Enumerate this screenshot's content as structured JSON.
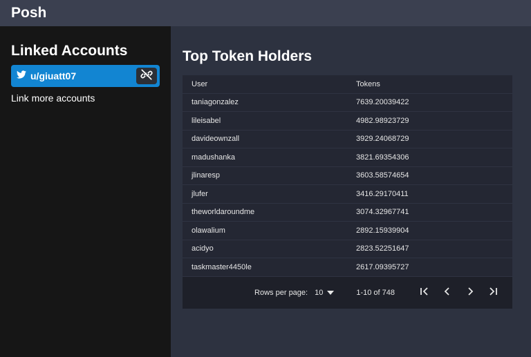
{
  "app": {
    "title": "Posh"
  },
  "sidebar": {
    "heading": "Linked Accounts",
    "account": {
      "name": "u/giuatt07",
      "icon": "twitter-icon"
    },
    "link_more": "Link more accounts"
  },
  "main": {
    "title": "Top Token Holders",
    "columns": [
      "User",
      "Tokens"
    ],
    "rows": [
      {
        "user": "taniagonzalez",
        "tokens": "7639.20039422"
      },
      {
        "user": "lileisabel",
        "tokens": "4982.98923729"
      },
      {
        "user": "davideownzall",
        "tokens": "3929.24068729"
      },
      {
        "user": "madushanka",
        "tokens": "3821.69354306"
      },
      {
        "user": "jlinaresp",
        "tokens": "3603.58574654"
      },
      {
        "user": "jlufer",
        "tokens": "3416.29170411"
      },
      {
        "user": "theworldaroundme",
        "tokens": "3074.32967741"
      },
      {
        "user": "olawalium",
        "tokens": "2892.15939904"
      },
      {
        "user": "acidyo",
        "tokens": "2823.52251647"
      },
      {
        "user": "taskmaster4450le",
        "tokens": "2617.09395727"
      }
    ],
    "pagination": {
      "rows_per_page_label": "Rows per page:",
      "rows_per_page_value": "10",
      "range": "1-10 of 748"
    }
  },
  "colors": {
    "accent": "#1285d2",
    "topbar": "#3b4050",
    "sidebar": "#161616",
    "background": "#2d3240"
  }
}
